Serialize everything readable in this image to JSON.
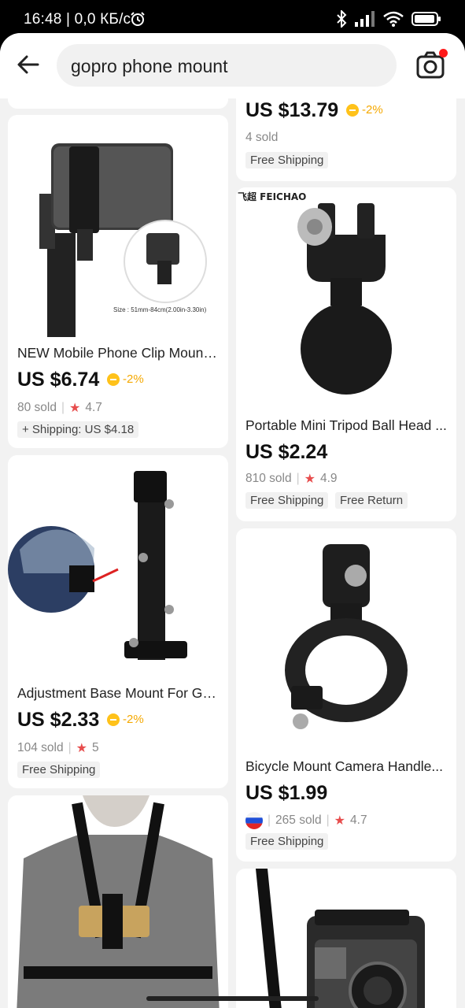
{
  "status_bar": {
    "time": "16:48 | 0,0 КБ/с"
  },
  "search": {
    "query": "gopro phone mount"
  },
  "products": [
    {
      "title": "NEW Mobile Phone Clip Mount ...",
      "price": "US $6.74",
      "discount": "-2%",
      "sold": "80 sold",
      "rating": "4.7",
      "tags": [
        "+ Shipping: US $4.18"
      ],
      "image_caption": "Size : 51mm-84cm(2.00in-3.30in)"
    },
    {
      "title": "Adjustment Base Mount For Go...",
      "price": "US $2.33",
      "discount": "-2%",
      "sold": "104 sold",
      "rating": "5",
      "tags": [
        "Free Shipping"
      ]
    },
    {
      "title": "",
      "price": "US $13.79",
      "discount": "-2%",
      "sold": "4 sold",
      "rating": "",
      "tags": [
        "Free Shipping"
      ]
    },
    {
      "title": "Portable Mini Tripod Ball Head ...",
      "price": "US $2.24",
      "discount": "",
      "sold": "810 sold",
      "rating": "4.9",
      "tags": [
        "Free Shipping",
        "Free Return"
      ],
      "brand": "飞超 FEICHAO"
    },
    {
      "title": "Bicycle Mount Camera Handle...",
      "price": "US $1.99",
      "discount": "",
      "sold": "265 sold",
      "rating": "4.7",
      "tags": [
        "Free Shipping"
      ],
      "flag": "russia"
    }
  ],
  "colors": {
    "accent_red": "#ff1a1a",
    "rating_star": "#e74d4d",
    "discount_gold": "#f5a800"
  }
}
